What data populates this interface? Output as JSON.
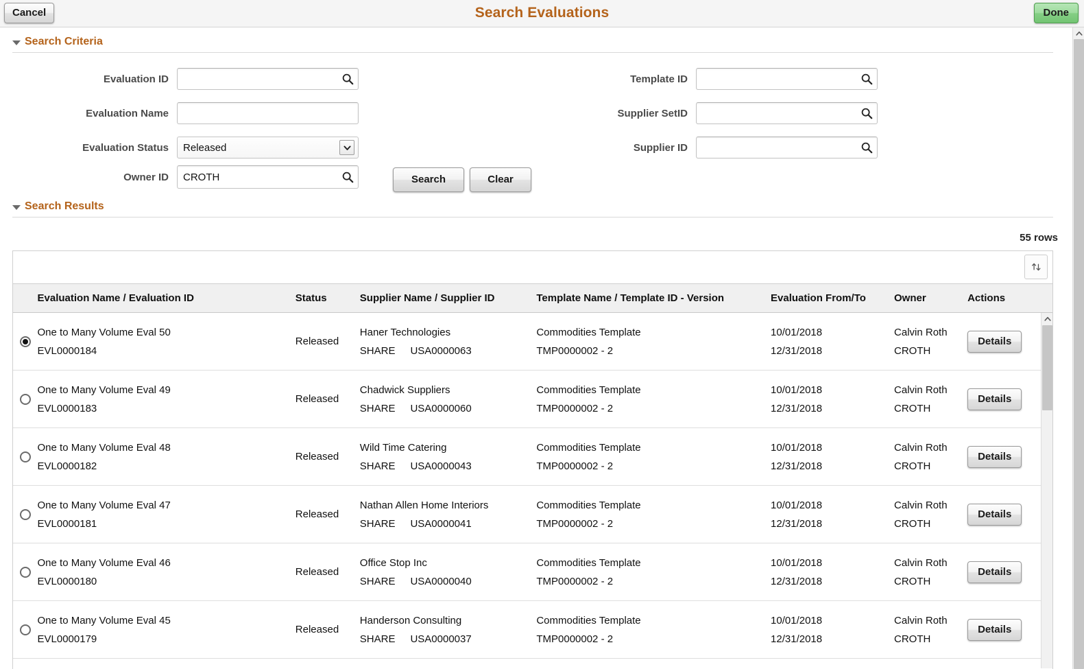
{
  "header": {
    "title": "Search Evaluations",
    "cancel_label": "Cancel",
    "done_label": "Done",
    "brand_color": "#b4631b",
    "done_color": "#8fd08f"
  },
  "search_criteria": {
    "section_title": "Search Criteria",
    "left_fields": [
      {
        "label": "Evaluation ID",
        "value": "",
        "placeholder": "",
        "type": "lookup"
      },
      {
        "label": "Evaluation Name",
        "value": "",
        "placeholder": "",
        "type": "text"
      },
      {
        "label": "Evaluation Status",
        "value": "Released",
        "placeholder": "",
        "type": "select",
        "options": [
          "Released"
        ]
      },
      {
        "label": "Owner ID",
        "value": "CROTH",
        "placeholder": "",
        "type": "lookup"
      }
    ],
    "right_fields": [
      {
        "label": "Template ID",
        "value": "",
        "placeholder": "",
        "type": "lookup"
      },
      {
        "label": "Supplier SetID",
        "value": "",
        "placeholder": "",
        "type": "lookup"
      },
      {
        "label": "Supplier ID",
        "value": "",
        "placeholder": "",
        "type": "lookup"
      }
    ],
    "search_label": "Search",
    "clear_label": "Clear"
  },
  "search_results": {
    "section_title": "Search Results",
    "rows_count_label": "55 rows",
    "sort_icon": "sort-updown-icon",
    "columns": [
      "Evaluation Name / Evaluation ID",
      "Status",
      "Supplier Name / Supplier ID",
      "Template Name / Template ID - Version",
      "Evaluation From/To",
      "Owner",
      "Actions"
    ],
    "details_label": "Details",
    "rows": [
      {
        "selected": true,
        "eval_name": "One to Many Volume Eval 50",
        "eval_id": "EVL0000184",
        "status": "Released",
        "supplier_name": "Haner Technologies",
        "supplier_setid": "SHARE",
        "supplier_id": "USA0000063",
        "template_name": "Commodities Template",
        "template_id_version": "TMP0000002 - 2",
        "date_from": "10/01/2018",
        "date_to": "12/31/2018",
        "owner_name": "Calvin Roth",
        "owner_id": "CROTH"
      },
      {
        "selected": false,
        "eval_name": "One to Many Volume Eval 49",
        "eval_id": "EVL0000183",
        "status": "Released",
        "supplier_name": "Chadwick Suppliers",
        "supplier_setid": "SHARE",
        "supplier_id": "USA0000060",
        "template_name": "Commodities Template",
        "template_id_version": "TMP0000002 - 2",
        "date_from": "10/01/2018",
        "date_to": "12/31/2018",
        "owner_name": "Calvin Roth",
        "owner_id": "CROTH"
      },
      {
        "selected": false,
        "eval_name": "One to Many Volume Eval 48",
        "eval_id": "EVL0000182",
        "status": "Released",
        "supplier_name": "Wild Time Catering",
        "supplier_setid": "SHARE",
        "supplier_id": "USA0000043",
        "template_name": "Commodities Template",
        "template_id_version": "TMP0000002 - 2",
        "date_from": "10/01/2018",
        "date_to": "12/31/2018",
        "owner_name": "Calvin Roth",
        "owner_id": "CROTH"
      },
      {
        "selected": false,
        "eval_name": "One to Many Volume Eval 47",
        "eval_id": "EVL0000181",
        "status": "Released",
        "supplier_name": "Nathan Allen Home Interiors",
        "supplier_setid": "SHARE",
        "supplier_id": "USA0000041",
        "template_name": "Commodities Template",
        "template_id_version": "TMP0000002 - 2",
        "date_from": "10/01/2018",
        "date_to": "12/31/2018",
        "owner_name": "Calvin Roth",
        "owner_id": "CROTH"
      },
      {
        "selected": false,
        "eval_name": "One to Many Volume Eval 46",
        "eval_id": "EVL0000180",
        "status": "Released",
        "supplier_name": "Office Stop Inc",
        "supplier_setid": "SHARE",
        "supplier_id": "USA0000040",
        "template_name": "Commodities Template",
        "template_id_version": "TMP0000002 - 2",
        "date_from": "10/01/2018",
        "date_to": "12/31/2018",
        "owner_name": "Calvin Roth",
        "owner_id": "CROTH"
      },
      {
        "selected": false,
        "eval_name": "One to Many Volume Eval 45",
        "eval_id": "EVL0000179",
        "status": "Released",
        "supplier_name": "Handerson Consulting",
        "supplier_setid": "SHARE",
        "supplier_id": "USA0000037",
        "template_name": "Commodities Template",
        "template_id_version": "TMP0000002 - 2",
        "date_from": "10/01/2018",
        "date_to": "12/31/2018",
        "owner_name": "Calvin Roth",
        "owner_id": "CROTH"
      }
    ]
  }
}
